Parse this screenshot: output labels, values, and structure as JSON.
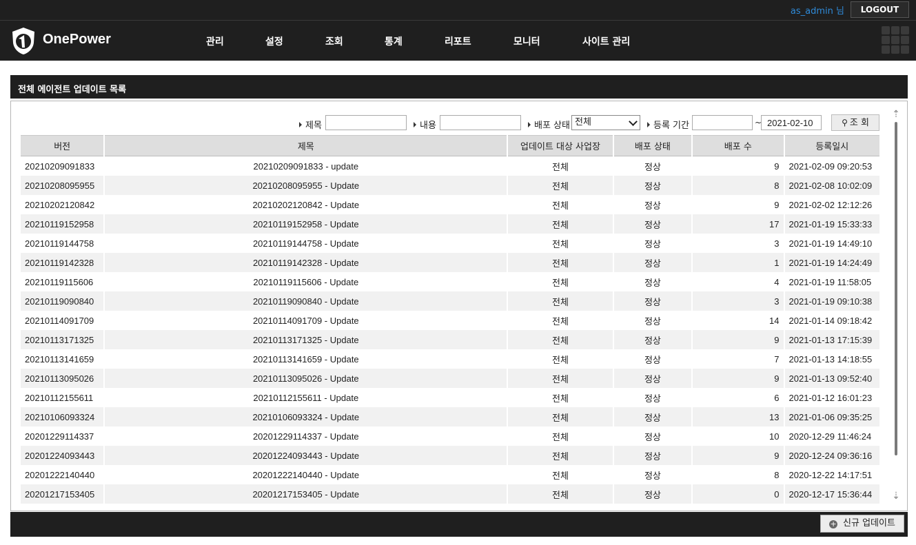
{
  "header": {
    "user_label": "as_admin 님",
    "logout_label": "LOGOUT",
    "brand": "OnePower",
    "menu": [
      "관리",
      "설정",
      "조회",
      "통계",
      "리포트",
      "모니터",
      "사이트 관리"
    ]
  },
  "panel": {
    "title": "전체 에이전트 업데이트 목록"
  },
  "filters": {
    "title_label": "제목",
    "title_value": "",
    "content_label": "내용",
    "content_value": "",
    "status_label": "배포 상태",
    "status_value": "전체",
    "period_label": "등록 기간",
    "period_from": "",
    "period_sep": "~",
    "period_to": "2021-02-10",
    "search_label": "조 회"
  },
  "table": {
    "columns": [
      "버전",
      "제목",
      "업데이트 대상 사업장",
      "배포 상태",
      "배포 수",
      "등록일시"
    ],
    "rows": [
      [
        "20210209091833",
        "20210209091833 - update",
        "전체",
        "정상",
        "9",
        "2021-02-09 09:20:53"
      ],
      [
        "20210208095955",
        "20210208095955 - Update",
        "전체",
        "정상",
        "8",
        "2021-02-08 10:02:09"
      ],
      [
        "20210202120842",
        "20210202120842 - Update",
        "전체",
        "정상",
        "9",
        "2021-02-02 12:12:26"
      ],
      [
        "20210119152958",
        "20210119152958 - Update",
        "전체",
        "정상",
        "17",
        "2021-01-19 15:33:33"
      ],
      [
        "20210119144758",
        "20210119144758 - Update",
        "전체",
        "정상",
        "3",
        "2021-01-19 14:49:10"
      ],
      [
        "20210119142328",
        "20210119142328 - Update",
        "전체",
        "정상",
        "1",
        "2021-01-19 14:24:49"
      ],
      [
        "20210119115606",
        "20210119115606 - Update",
        "전체",
        "정상",
        "4",
        "2021-01-19 11:58:05"
      ],
      [
        "20210119090840",
        "20210119090840 - Update",
        "전체",
        "정상",
        "3",
        "2021-01-19 09:10:38"
      ],
      [
        "20210114091709",
        "20210114091709 - Update",
        "전체",
        "정상",
        "14",
        "2021-01-14 09:18:42"
      ],
      [
        "20210113171325",
        "20210113171325 - Update",
        "전체",
        "정상",
        "9",
        "2021-01-13 17:15:39"
      ],
      [
        "20210113141659",
        "20210113141659 - Update",
        "전체",
        "정상",
        "7",
        "2021-01-13 14:18:55"
      ],
      [
        "20210113095026",
        "20210113095026 - Update",
        "전체",
        "정상",
        "9",
        "2021-01-13 09:52:40"
      ],
      [
        "20210112155611",
        "20210112155611 - Update",
        "전체",
        "정상",
        "6",
        "2021-01-12 16:01:23"
      ],
      [
        "20210106093324",
        "20210106093324 - Update",
        "전체",
        "정상",
        "13",
        "2021-01-06 09:35:25"
      ],
      [
        "20201229114337",
        "20201229114337 - Update",
        "전체",
        "정상",
        "10",
        "2020-12-29 11:46:24"
      ],
      [
        "20201224093443",
        "20201224093443 - Update",
        "전체",
        "정상",
        "9",
        "2020-12-24 09:36:16"
      ],
      [
        "20201222140440",
        "20201222140440 - Update",
        "전체",
        "정상",
        "8",
        "2020-12-22 14:17:51"
      ],
      [
        "20201217153405",
        "20201217153405 - Update",
        "전체",
        "정상",
        "0",
        "2020-12-17 15:36:44"
      ]
    ]
  },
  "footer": {
    "new_update_label": "신규 업데이트"
  },
  "colors": {
    "bar_background": "#1f1f1f",
    "user_link": "#2f8ad8",
    "header_cell": "#dedede",
    "alt_row": "#f1f1f1"
  }
}
